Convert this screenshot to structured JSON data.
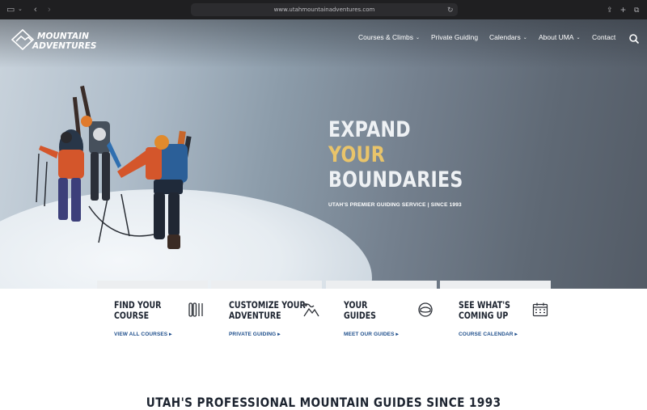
{
  "browser": {
    "url": "www.utahmountainadventures.com"
  },
  "logo": {
    "text_line1": "MOUNTAIN",
    "text_line2": "ADVENTURES"
  },
  "nav": {
    "items": [
      {
        "label": "Courses & Climbs",
        "dropdown": true
      },
      {
        "label": "Private Guiding",
        "dropdown": false
      },
      {
        "label": "Calendars",
        "dropdown": true
      },
      {
        "label": "About UMA",
        "dropdown": true
      },
      {
        "label": "Contact",
        "dropdown": false
      }
    ]
  },
  "hero": {
    "line1": "EXPAND",
    "line2": "YOUR",
    "line3": "BOUNDARIES",
    "tagline": "UTAH'S PREMIER GUIDING SERVICE  |  SINCE 1993",
    "accent_color": "#e9c46a"
  },
  "cards": [
    {
      "title1": "FIND YOUR",
      "title2": "COURSE",
      "link": "VIEW ALL COURSES",
      "icon": "skis-icon"
    },
    {
      "title1": "CUSTOMIZE YOUR",
      "title2": "ADVENTURE",
      "link": "PRIVATE GUIDING",
      "icon": "mountain-route-icon"
    },
    {
      "title1": "YOUR",
      "title2": "GUIDES",
      "link": "MEET OUR GUIDES",
      "icon": "goggles-icon"
    },
    {
      "title1": "SEE WHAT'S",
      "title2": "COMING UP",
      "link": "COURSE CALENDAR",
      "icon": "calendar-icon"
    }
  ],
  "section": {
    "heading": "UTAH'S PROFESSIONAL MOUNTAIN GUIDES SINCE 1993"
  },
  "colors": {
    "link": "#1f4f8c",
    "heading": "#1d2430"
  }
}
